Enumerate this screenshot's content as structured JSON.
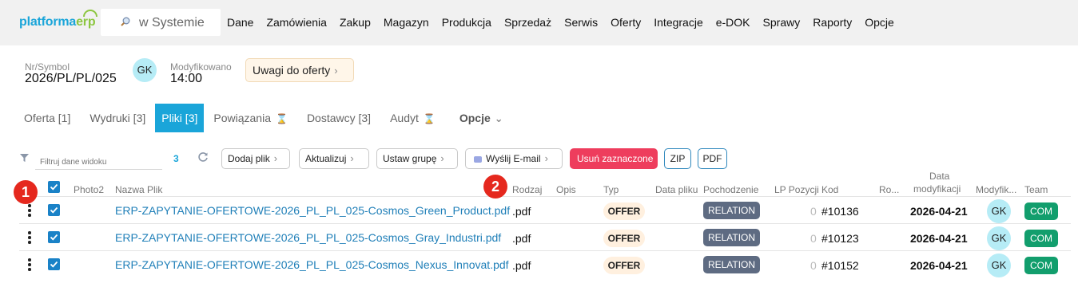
{
  "app": {
    "logo_main": "platforma",
    "logo_accent": "erp",
    "search_text": "w Systemie",
    "menu": [
      "Dane",
      "Zamówienia",
      "Zakup",
      "Magazyn",
      "Produkcja",
      "Sprzedaż",
      "Serwis",
      "Oferty",
      "Integracje",
      "e-DOK",
      "Sprawy",
      "Raporty",
      "Opcje"
    ]
  },
  "header": {
    "symbol_label": "Nr/Symbol",
    "symbol_value": "2026/PL/PL/025",
    "avatar": "GK",
    "modified_label": "Modyfikowano",
    "modified_value": "14:00",
    "notes_button": "Uwagi do oferty"
  },
  "tabs": [
    {
      "label": "Oferta [1]",
      "active": false
    },
    {
      "label": "Wydruki [3]",
      "active": false
    },
    {
      "label": "Pliki [3]",
      "active": true
    },
    {
      "label": "Powiązania",
      "active": false,
      "icon": "hourglass-icon"
    },
    {
      "label": "Dostawcy [3]",
      "active": false
    },
    {
      "label": "Audyt",
      "active": false,
      "icon": "hourglass-icon"
    },
    {
      "label": "Opcje",
      "active": false,
      "icon": "chevron-down-icon"
    }
  ],
  "toolbar": {
    "filter_placeholder": "Filtruj dane widoku",
    "count": "3",
    "buttons": {
      "add_file": "Dodaj plik",
      "update": "Aktualizuj",
      "set_group": "Ustaw grupę",
      "send_email": "Wyślij E-mail",
      "delete_selected": "Usuń zaznaczone",
      "zip": "ZIP",
      "pdf": "PDF"
    },
    "colors": {
      "accent": "#1aa5d9",
      "danger": "#ee3d5d",
      "checkbox": "#1a82c7"
    }
  },
  "table": {
    "columns": {
      "photo2": "Photo2",
      "name": "Nazwa Plik",
      "kind": "Rodzaj",
      "description": "Opis",
      "type": "Typ",
      "file_date": "Data pliku",
      "origin": "Pochodzenie",
      "lp": "LP Pozycji",
      "code": "Kod",
      "ro": "Ro...",
      "mod_date_line1": "Data",
      "mod_date_line2": "modyfikacji",
      "modified_by": "Modyfik...",
      "team": "Team"
    },
    "rows": [
      {
        "name": "ERP-ZAPYTANIE-OFERTOWE-2026_PL_PL_025-Cosmos_Green_Product.pdf",
        "kind": ".pdf",
        "type": "OFFER",
        "origin": "RELATION",
        "lp": "0",
        "code": "#10136",
        "date": "2026-04-21",
        "modified_by": "GK",
        "team": "COM"
      },
      {
        "name": "ERP-ZAPYTANIE-OFERTOWE-2026_PL_PL_025-Cosmos_Gray_Industri.pdf",
        "kind": ".pdf",
        "type": "OFFER",
        "origin": "RELATION",
        "lp": "0",
        "code": "#10123",
        "date": "2026-04-21",
        "modified_by": "GK",
        "team": "COM"
      },
      {
        "name": "ERP-ZAPYTANIE-OFERTOWE-2026_PL_PL_025-Cosmos_Nexus_Innovat.pdf",
        "kind": ".pdf",
        "type": "OFFER",
        "origin": "RELATION",
        "lp": "0",
        "code": "#10152",
        "date": "2026-04-21",
        "modified_by": "GK",
        "team": "COM"
      }
    ]
  },
  "markers": [
    "1",
    "2"
  ]
}
